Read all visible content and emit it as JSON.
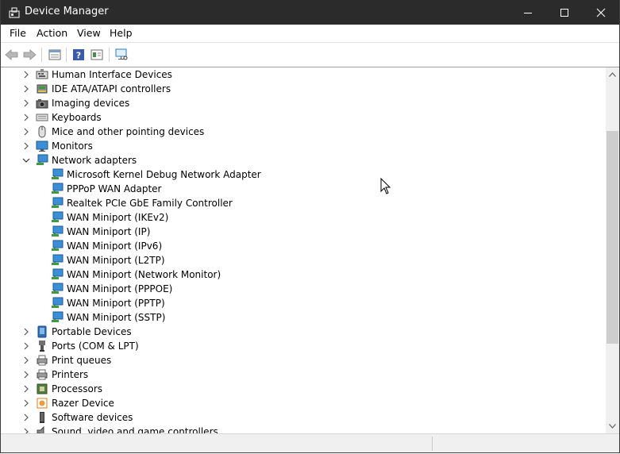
{
  "window": {
    "title": "Device Manager"
  },
  "menu": [
    "File",
    "Action",
    "View",
    "Help"
  ],
  "toolbar": {
    "icons": [
      "back-arrow-icon",
      "forward-arrow-icon",
      "properties-icon",
      "help-icon",
      "update-driver-icon",
      "scan-hardware-icon"
    ]
  },
  "tree": {
    "top_before": [
      {
        "label": "Human Interface Devices",
        "icon": "hid-icon"
      },
      {
        "label": "IDE ATA/ATAPI controllers",
        "icon": "ide-controller-icon"
      },
      {
        "label": "Imaging devices",
        "icon": "camera-icon"
      },
      {
        "label": "Keyboards",
        "icon": "keyboard-icon"
      },
      {
        "label": "Mice and other pointing devices",
        "icon": "mouse-icon"
      },
      {
        "label": "Monitors",
        "icon": "monitor-icon"
      }
    ],
    "expanded": {
      "label": "Network adapters",
      "icon": "network-adapter-icon",
      "children": [
        "Microsoft Kernel Debug Network Adapter",
        "PPPoP WAN Adapter",
        "Realtek PCIe GbE Family Controller",
        "WAN Miniport (IKEv2)",
        "WAN Miniport (IP)",
        "WAN Miniport (IPv6)",
        "WAN Miniport (L2TP)",
        "WAN Miniport (Network Monitor)",
        "WAN Miniport (PPPOE)",
        "WAN Miniport (PPTP)",
        "WAN Miniport (SSTP)"
      ]
    },
    "top_after": [
      {
        "label": "Portable Devices",
        "icon": "portable-device-icon"
      },
      {
        "label": "Ports (COM & LPT)",
        "icon": "port-icon"
      },
      {
        "label": "Print queues",
        "icon": "print-queue-icon"
      },
      {
        "label": "Printers",
        "icon": "printer-icon"
      },
      {
        "label": "Processors",
        "icon": "processor-icon"
      },
      {
        "label": "Razer Device",
        "icon": "razer-device-icon"
      },
      {
        "label": "Software devices",
        "icon": "software-device-icon"
      },
      {
        "label": "Sound, video and game controllers",
        "icon": "sound-icon"
      }
    ]
  }
}
